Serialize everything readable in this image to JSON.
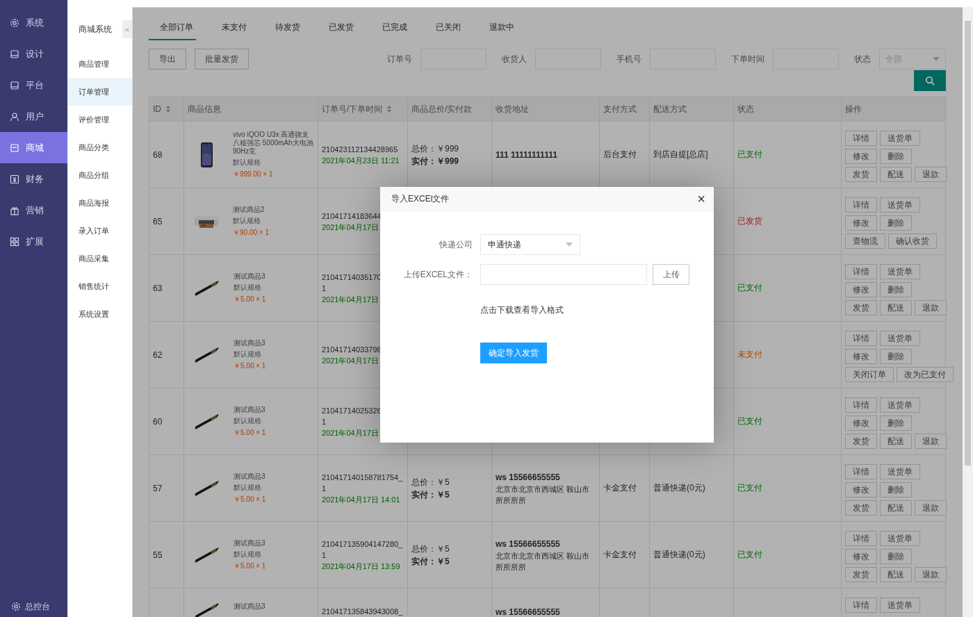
{
  "nav": {
    "items": [
      {
        "label": "系统",
        "selected": false
      },
      {
        "label": "设计",
        "selected": false
      },
      {
        "label": "平台",
        "selected": false
      },
      {
        "label": "用户",
        "selected": false
      },
      {
        "label": "商城",
        "selected": true
      },
      {
        "label": "财务",
        "selected": false
      },
      {
        "label": "营销",
        "selected": false
      },
      {
        "label": "扩展",
        "selected": false
      }
    ],
    "footer": "总控台"
  },
  "subnav": {
    "title": "商城系统",
    "collapse": "«",
    "items": [
      {
        "label": "商品管理",
        "selected": false
      },
      {
        "label": "订单管理",
        "selected": true
      },
      {
        "label": "评价管理",
        "selected": false
      },
      {
        "label": "商品分类",
        "selected": false
      },
      {
        "label": "商品分组",
        "selected": false
      },
      {
        "label": "商品海报",
        "selected": false
      },
      {
        "label": "录入订单",
        "selected": false
      },
      {
        "label": "商品采集",
        "selected": false
      },
      {
        "label": "销售统计",
        "selected": false
      },
      {
        "label": "系统设置",
        "selected": false
      }
    ]
  },
  "tabs": [
    {
      "label": "全部订单",
      "selected": true
    },
    {
      "label": "未支付",
      "selected": false
    },
    {
      "label": "待发货",
      "selected": false
    },
    {
      "label": "已发货",
      "selected": false
    },
    {
      "label": "已完成",
      "selected": false
    },
    {
      "label": "已关闭",
      "selected": false
    },
    {
      "label": "退款中",
      "selected": false
    }
  ],
  "toolbar": {
    "buttons": [
      "导出",
      "批量发货"
    ],
    "filters": [
      {
        "label": "订单号",
        "kind": "input"
      },
      {
        "label": "收货人",
        "kind": "input"
      },
      {
        "label": "手机号",
        "kind": "input"
      },
      {
        "label": "下单时间",
        "kind": "input"
      },
      {
        "label": "状态",
        "kind": "select",
        "value": "全部"
      }
    ]
  },
  "table": {
    "columns": [
      {
        "label": "ID",
        "sortable": true
      },
      {
        "label": "商品信息",
        "sortable": false
      },
      {
        "label": "订单号/下单时间",
        "sortable": true
      },
      {
        "label": "商品总价/实付款",
        "sortable": false
      },
      {
        "label": "收货地址",
        "sortable": false
      },
      {
        "label": "支付方式",
        "sortable": false
      },
      {
        "label": "配送方式",
        "sortable": false
      },
      {
        "label": "状态",
        "sortable": false
      },
      {
        "label": "操作",
        "sortable": false
      }
    ],
    "rows": [
      {
        "id": "68",
        "product": {
          "name": "vivo iQOO U3x 高通骁龙八核强芯 5000mAh大电池 90Hz竞",
          "spec": "默认规格",
          "price": "￥999.00 × 1"
        },
        "order": [
          "210423112134428965"
        ],
        "time": "2021年04月23日 11:21",
        "total": "总价：￥999",
        "paid": "实付：￥999",
        "receiver": "111 11111111111",
        "payment": "后台支付",
        "delivery": "到店自提[总店]",
        "status": {
          "label": "已支付",
          "kind": "paid"
        },
        "actions": [
          [
            "详情",
            "送货单"
          ],
          [
            "修改",
            "删除"
          ],
          [
            "发货",
            "配送",
            "退款"
          ]
        ]
      },
      {
        "id": "65",
        "product": {
          "name": "测试商品2",
          "spec": "默认规格",
          "price": "￥90.00 × 1"
        },
        "order": [
          "21041714183644"
        ],
        "time": "2021年04月17日",
        "status": {
          "label": "已发货",
          "kind": "shipped"
        },
        "actions": [
          [
            "详情",
            "送货单"
          ],
          [
            "修改",
            "删除"
          ],
          [
            "查物流",
            "确认收货"
          ]
        ]
      },
      {
        "id": "63",
        "product": {
          "name": "测试商品3",
          "spec": "默认规格",
          "price": "￥5.00 × 1"
        },
        "order": [
          "21041714035170",
          "1"
        ],
        "time": "2021年04月17日",
        "status": {
          "label": "已支付",
          "kind": "paid"
        },
        "actions": [
          [
            "详情",
            "送货单"
          ],
          [
            "修改",
            "删除"
          ],
          [
            "发货",
            "配送",
            "退款"
          ]
        ]
      },
      {
        "id": "62",
        "product": {
          "name": "测试商品3",
          "spec": "默认规格",
          "price": "￥5.00 × 1"
        },
        "order": [
          "21041714033798"
        ],
        "time": "2021年04月17日",
        "status": {
          "label": "未支付",
          "kind": "unpaid"
        },
        "actions": [
          [
            "详情",
            "送货单"
          ],
          [
            "修改",
            "删除"
          ],
          [
            "关闭订单",
            "改为已支付"
          ]
        ]
      },
      {
        "id": "60",
        "product": {
          "name": "测试商品3",
          "spec": "默认规格",
          "price": "￥5.00 × 1"
        },
        "order": [
          "21041714025326",
          "1"
        ],
        "time": "2021年04月17日",
        "status": {
          "label": "已支付",
          "kind": "paid"
        },
        "actions": [
          [
            "详情",
            "送货单"
          ],
          [
            "修改",
            "删除"
          ],
          [
            "发货",
            "配送",
            "退款"
          ]
        ]
      },
      {
        "id": "57",
        "product": {
          "name": "测试商品3",
          "spec": "默认规格",
          "price": "￥5.00 × 1"
        },
        "order": [
          "210417140158781754_",
          "1"
        ],
        "time": "2021年04月17日 14:01",
        "total": "总价：￥5",
        "paid": "实付：￥5",
        "receiver": "ws 15566655555",
        "address": "北京市北京市西城区 鞍山市所所所所",
        "payment": "卡金支付",
        "delivery": "普通快递(0元)",
        "status": {
          "label": "已支付",
          "kind": "paid"
        },
        "actions": [
          [
            "详情",
            "送货单"
          ],
          [
            "修改",
            "删除"
          ],
          [
            "发货",
            "配送",
            "退款"
          ]
        ]
      },
      {
        "id": "55",
        "product": {
          "name": "测试商品3",
          "spec": "默认规格",
          "price": "￥5.00 × 1"
        },
        "order": [
          "210417135904147280_",
          "1"
        ],
        "time": "2021年04月17日 13:59",
        "total": "总价：￥5",
        "paid": "实付：￥5",
        "receiver": "ws 15566655555",
        "address": "北京市北京市西城区 鞍山市所所所所",
        "payment": "卡金支付",
        "delivery": "普通快递(0元)",
        "status": {
          "label": "已支付",
          "kind": "paid"
        },
        "actions": [
          [
            "详情",
            "送货单"
          ],
          [
            "修改",
            "删除"
          ],
          [
            "发货",
            "配送",
            "退款"
          ]
        ]
      },
      {
        "product": {
          "name": "测试商品3"
        },
        "order": [
          "210417135843943008_"
        ],
        "receiver": "ws 15566655555",
        "actions": [
          [
            "详情",
            "送货单"
          ]
        ]
      }
    ]
  },
  "dialog": {
    "title": "导入EXCEl文件",
    "close": "×",
    "courier_label": "快递公司",
    "courier_value": "申通快递",
    "file_label": "上传EXCEL文件：",
    "upload_button": "上传",
    "template_link": "点击下载查看导入格式",
    "submit_button": "确定导入发货"
  }
}
